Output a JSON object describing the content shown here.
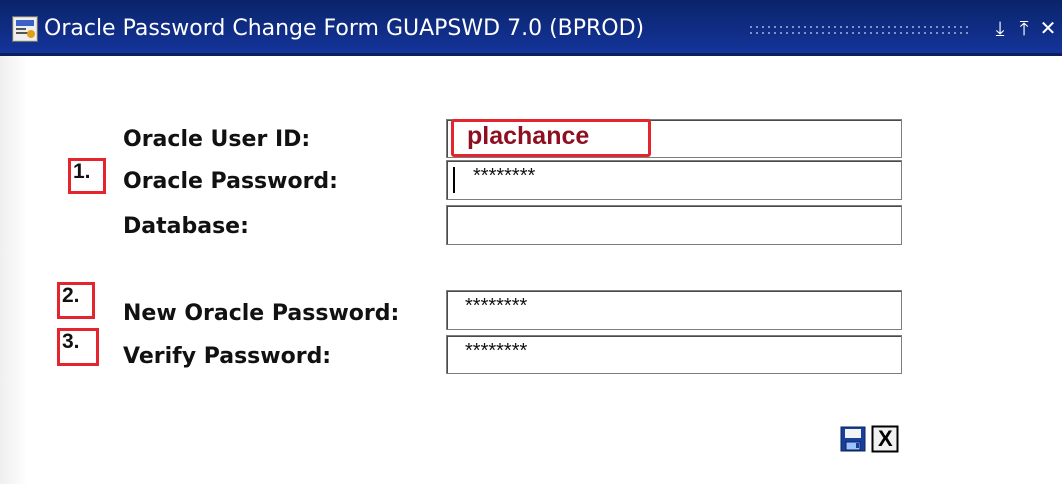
{
  "window": {
    "title": "Oracle Password Change Form  GUAPSWD  7.0  (BPROD)",
    "minimize_glyph": "⤓",
    "restore_glyph": "⤒",
    "close_glyph": "✕",
    "icon": "form-app-icon"
  },
  "form": {
    "user_id": {
      "label": "Oracle User ID:",
      "value": "plachance"
    },
    "password": {
      "label": "Oracle Password:",
      "value": "********"
    },
    "database": {
      "label": "Database:",
      "value": ""
    },
    "new_password": {
      "label": "New Oracle Password:",
      "value": "********"
    },
    "verify_password": {
      "label": "Verify Password:",
      "value": "********"
    }
  },
  "callouts": {
    "step1": "1.",
    "step2": "2.",
    "step3": "3."
  },
  "toolbar": {
    "save_icon": "save-disk-icon",
    "close_label": "X"
  },
  "colors": {
    "titlebar": "#0a246a",
    "callout_border": "#e5252d",
    "user_id_text": "#8e1020"
  }
}
